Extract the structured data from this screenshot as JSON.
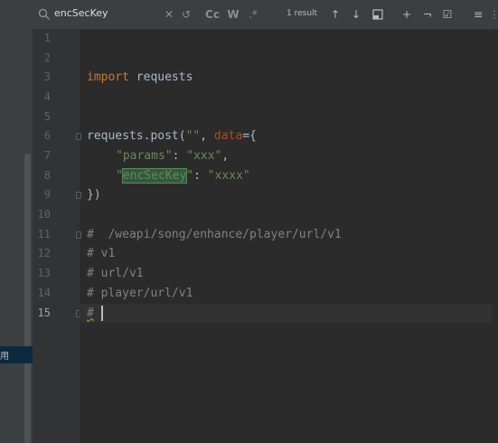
{
  "search": {
    "query": "encSecKey",
    "result_count": "1 result",
    "match_case_label": "Cc",
    "words_label": "W",
    "regex_label": ".*"
  },
  "left_panel": {
    "selected_label": "用"
  },
  "gutter": {
    "line_numbers": [
      "1",
      "2",
      "3",
      "4",
      "5",
      "6",
      "7",
      "8",
      "9",
      "10",
      "11",
      "12",
      "13",
      "14",
      "15"
    ],
    "current_line": "15"
  },
  "code": {
    "line3": {
      "kw": "import",
      "rest": " requests"
    },
    "line6": {
      "a": "requests.post(",
      "str": "\"\"",
      "b": ", ",
      "param": "data",
      "c": "={"
    },
    "line7": {
      "key": "\"params\"",
      "sep": ": ",
      "val": "\"xxx\"",
      "end": ","
    },
    "line8": {
      "q1": "\"",
      "match": "encSecKey",
      "q2": "\"",
      "sep": ": ",
      "val": "\"xxxx\""
    },
    "line9": "})",
    "line11": "#  /weapi/song/enhance/player/url/v1",
    "line12": "# v1",
    "line13": "# url/v1",
    "line14": "# player/url/v1",
    "line15": "#"
  },
  "colors": {
    "background": "#2b2b2b",
    "keyword": "#cc7832",
    "string": "#6a8759",
    "param": "#aa4926",
    "comment": "#808080",
    "match_highlight": "#32593d"
  }
}
